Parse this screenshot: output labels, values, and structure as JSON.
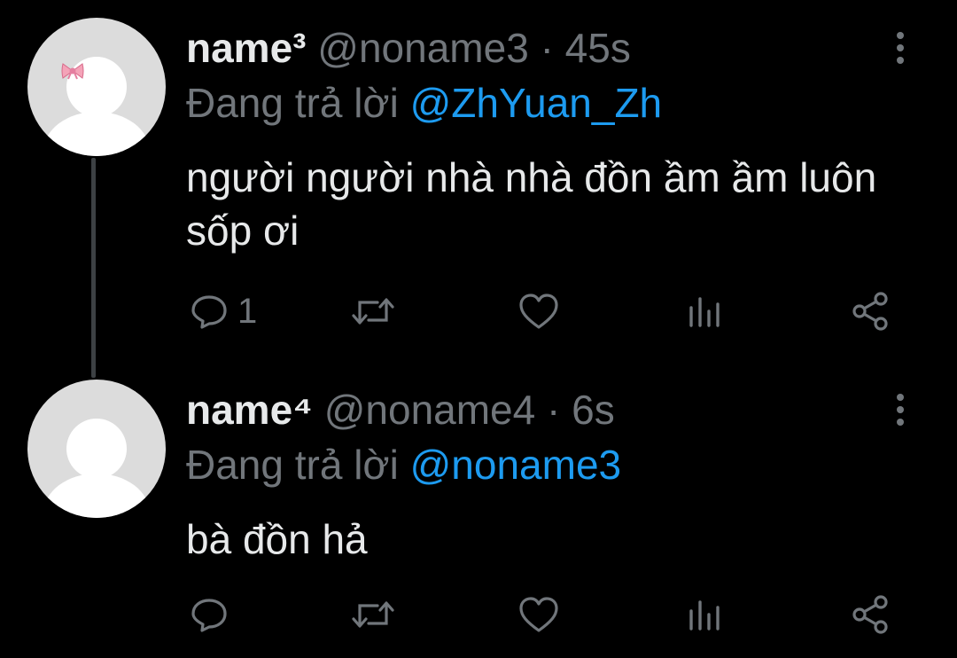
{
  "colors": {
    "background": "#000000",
    "text_primary": "#e7e9ea",
    "text_secondary": "#71767b",
    "accent_link": "#1d9bf0",
    "avatar_bg": "#dcdcdc",
    "thread_line": "#3d4144"
  },
  "tweets": [
    {
      "display_name": "name³",
      "handle": "@noname3",
      "separator": "·",
      "time": "45s",
      "reply_prefix": "Đang trả lời",
      "reply_to": "@ZhYuan_Zh",
      "text": "người người nhà nhà đồn ầm ầm luôn sốp ơi",
      "reply_count": "1",
      "avatar_decoration_icon": "bow-icon"
    },
    {
      "display_name": "name⁴",
      "handle": "@noname4",
      "separator": "·",
      "time": "6s",
      "reply_prefix": "Đang trả lời",
      "reply_to": "@noname3",
      "text": "bà đồn hả",
      "reply_count": ""
    }
  ]
}
